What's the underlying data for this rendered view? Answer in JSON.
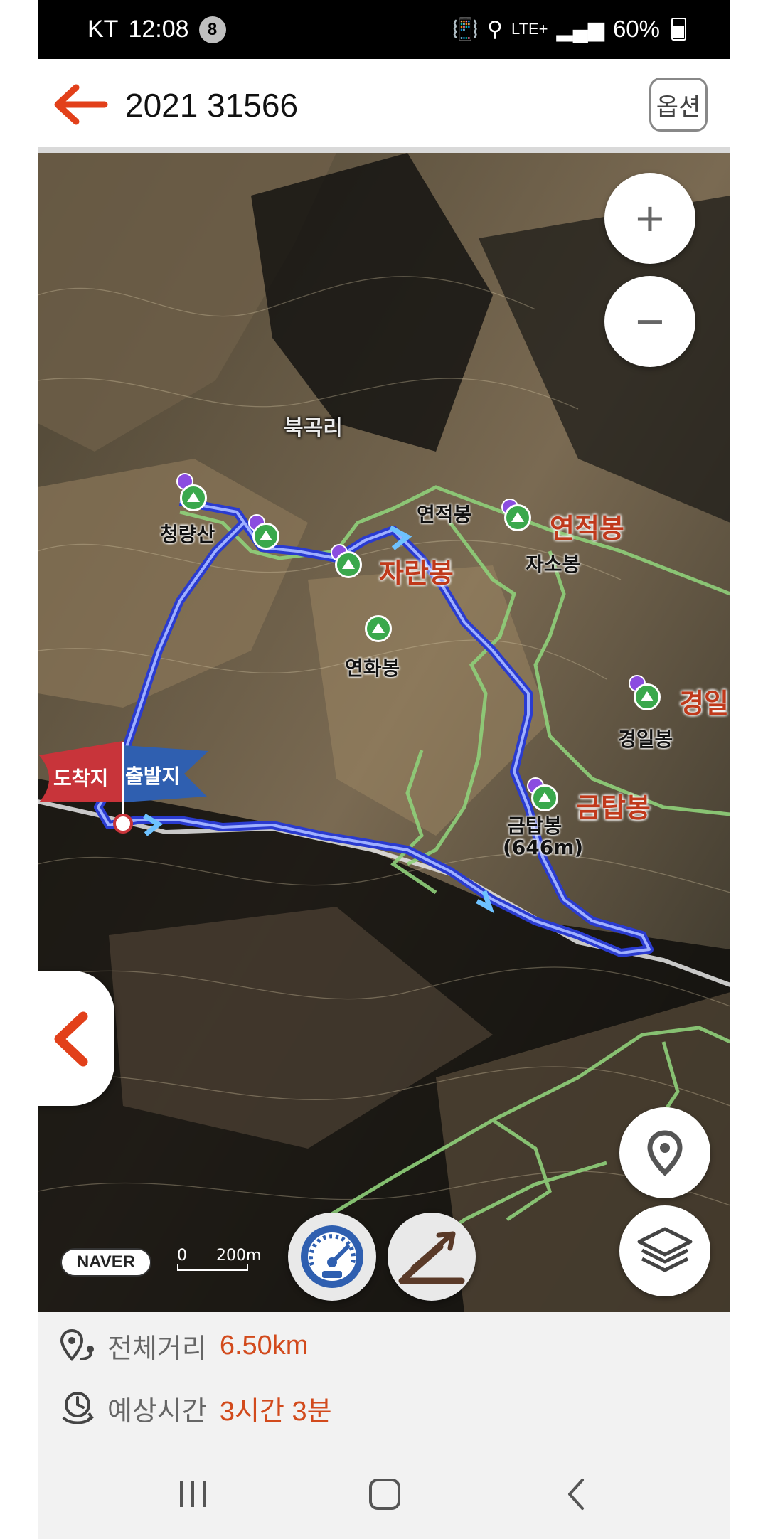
{
  "status_bar": {
    "carrier": "KT",
    "time": "12:08",
    "notification_count": "8",
    "network": "LTE+",
    "battery": "60%"
  },
  "header": {
    "title": "2021 31566",
    "option_label": "옵션"
  },
  "map": {
    "place_labels": [
      "북곡리"
    ],
    "peaks": [
      {
        "name": "청량산",
        "style": "normal"
      },
      {
        "name": "연적봉",
        "style": "normal"
      },
      {
        "name": "연적봉",
        "style": "highlight"
      },
      {
        "name": "자란봉",
        "style": "highlight"
      },
      {
        "name": "자소봉",
        "style": "normal"
      },
      {
        "name": "연화봉",
        "style": "normal"
      },
      {
        "name": "경일봉",
        "style": "normal"
      },
      {
        "name": "경일",
        "style": "highlight"
      },
      {
        "name": "금탑봉",
        "style": "normal"
      },
      {
        "name": "(646m)",
        "style": "normal"
      },
      {
        "name": "금탑봉",
        "style": "highlight"
      }
    ],
    "flags": {
      "arrival": "도착지",
      "departure": "출발지"
    },
    "zoom_in": "+",
    "zoom_out": "−",
    "provider": "NAVER",
    "scale_zero": "0",
    "scale_distance": "200m",
    "colors": {
      "route": "#3a4fd8",
      "trail": "#8fd07a",
      "arrival_flag": "#c8343a",
      "departure_flag": "#2f5fb0"
    },
    "icons": [
      "location-pin-icon",
      "layers-icon",
      "speedometer-icon",
      "elevation-icon",
      "chevron-left-icon"
    ]
  },
  "info": {
    "distance_label": "전체거리",
    "distance_value": "6.50km",
    "time_label": "예상시간",
    "time_value": "3시간 3분"
  },
  "accent_color": "#d24a1c"
}
